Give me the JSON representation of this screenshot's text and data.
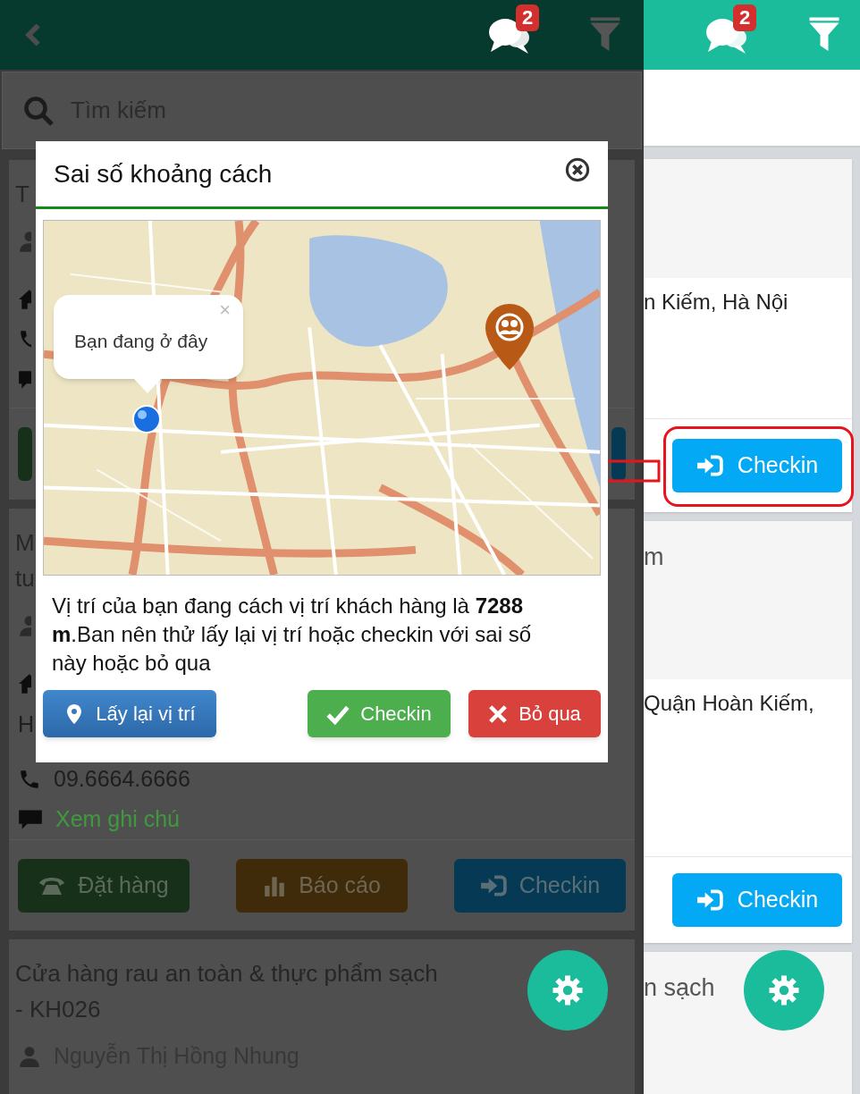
{
  "left_screen": {
    "header": {
      "badge": "2"
    },
    "search": {
      "placeholder": "Tìm kiếm"
    },
    "cards": [
      {
        "title_lines": [
          "T"
        ],
        "rows": [
          {
            "kind": "contact"
          },
          {
            "kind": "address"
          },
          {
            "kind": "phone"
          },
          {
            "kind": "note"
          }
        ],
        "buttons": [
          {
            "kind": "order"
          },
          {
            "kind": "checkin"
          }
        ]
      },
      {
        "title_lines": [
          "M",
          "tu"
        ],
        "rows": [
          {
            "kind": "contact"
          },
          {
            "kind": "address"
          },
          {
            "kind": "text",
            "text": "H"
          },
          {
            "kind": "phone",
            "text": "09.6664.6666"
          },
          {
            "kind": "note",
            "text": "Xem ghi chú"
          }
        ],
        "buttons": [
          {
            "kind": "order",
            "label": "Đặt hàng"
          },
          {
            "kind": "report",
            "label": "Báo cáo"
          },
          {
            "kind": "checkin",
            "label": "Checkin"
          }
        ]
      },
      {
        "title_lines": [
          "Cửa hàng rau an toàn & thực phẩm sạch",
          "- KH026"
        ],
        "rows": [
          {
            "kind": "contact",
            "text": "Nguyễn Thị Hồng Nhung"
          }
        ]
      }
    ]
  },
  "right_screen": {
    "header": {
      "badge": "2"
    },
    "cards": [
      {
        "address": "n Kiếm, Hà Nội",
        "button": "Checkin",
        "highlighted": true
      },
      {
        "title": "m",
        "address": "Quận Hoàn Kiếm,",
        "button": "Checkin",
        "highlighted": false
      },
      {
        "title": "n sạch"
      }
    ]
  },
  "dialog": {
    "title": "Sai số khoảng cách",
    "popup": {
      "text": "Bạn đang ở đây",
      "close": "×"
    },
    "message": "Vị trí của bạn đang cách vị trí khách hàng là **7288 m**.Ban nên thử lấy lại vị trí hoặc checkin với sai số này hoặc bỏ qua",
    "buttons": [
      {
        "kind": "relocate",
        "label": "Lấy lại vị trí"
      },
      {
        "kind": "confirm",
        "label": "Checkin"
      },
      {
        "kind": "cancel",
        "label": "Bỏ qua"
      }
    ]
  }
}
